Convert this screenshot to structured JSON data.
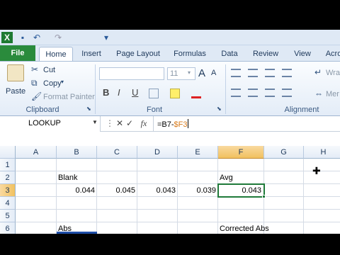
{
  "quick_access": {
    "items": [
      {
        "name": "excel-logo-icon",
        "glyph": "X"
      },
      {
        "name": "save-icon",
        "glyph": "▪"
      },
      {
        "name": "undo-icon",
        "glyph": "↶"
      },
      {
        "name": "redo-icon",
        "glyph": "↷"
      },
      {
        "name": "customize-qat-icon",
        "glyph": "▾"
      }
    ]
  },
  "tabs": [
    "File",
    "Home",
    "Insert",
    "Page Layout",
    "Formulas",
    "Data",
    "Review",
    "View",
    "Acro"
  ],
  "clipboard": {
    "paste": "Paste",
    "cut": "Cut",
    "copy": "Copy",
    "format_painter": "Format Painter",
    "group_label": "Clipboard"
  },
  "font_group": {
    "size": "11",
    "grow_glyph": "A",
    "shrink_glyph": "A",
    "bold": "B",
    "italic": "I",
    "underline": "U",
    "group_label": "Font"
  },
  "alignment": {
    "wrap": "Wra",
    "merge": "Mer",
    "group_label": "Alignment"
  },
  "formula_bar": {
    "name_box": "LOOKUP",
    "cancel": "✕",
    "enter": "✓",
    "fx": "fx",
    "formula_prefix": "=B7-",
    "formula_ref": "$F3"
  },
  "grid": {
    "columns": [
      "A",
      "B",
      "C",
      "D",
      "E",
      "F",
      "G",
      "H"
    ],
    "rows": [
      "1",
      "2",
      "3",
      "4",
      "5",
      "6"
    ],
    "cells": {
      "B2": "Blank",
      "F2": "Avg",
      "B3": "0.044",
      "C3": "0.045",
      "D3": "0.043",
      "E3": "0.039",
      "F3": "0.043",
      "B6": "Abs",
      "F6": "Corrected Abs"
    }
  },
  "colors": {
    "file_tab": "#2a8b3c",
    "active_cell_border": "#1f7a3a",
    "formula_ref": "#d87a1a",
    "selected_header": "#f1c15f"
  }
}
